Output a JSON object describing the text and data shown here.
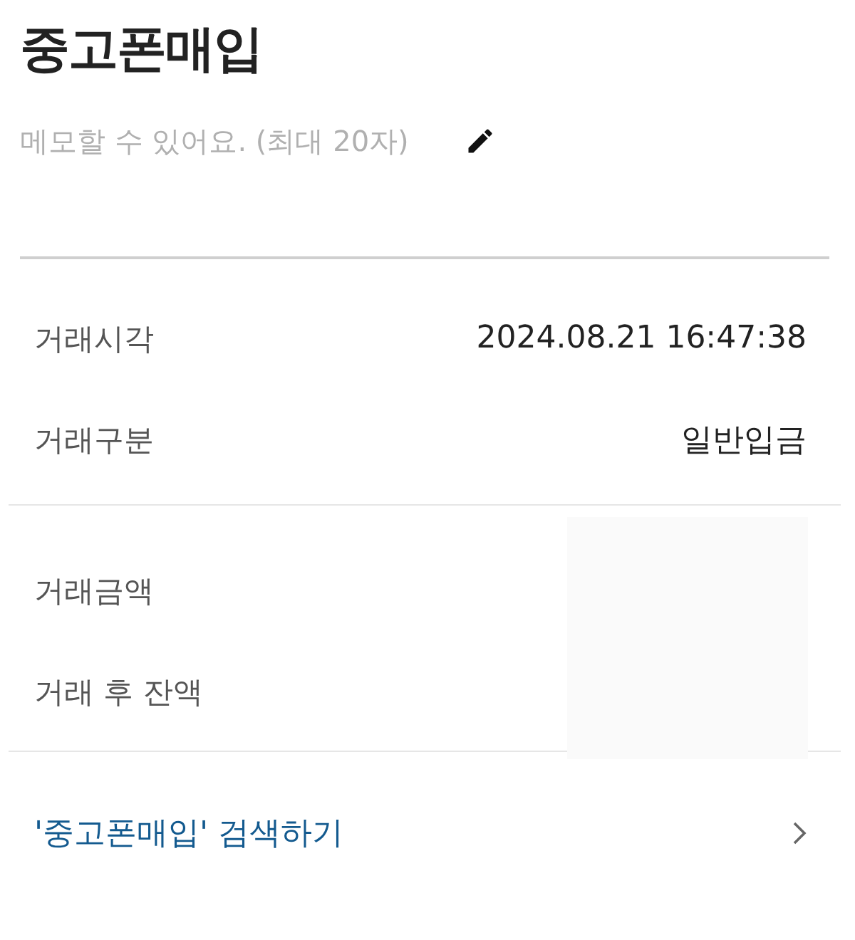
{
  "title": "중고폰매입",
  "memo": {
    "placeholder": "메모할 수 있어요. (최대 20자)"
  },
  "details": [
    {
      "label": "거래시각",
      "value": "2024.08.21 16:47:38"
    },
    {
      "label": "거래구분",
      "value": "일반입금"
    }
  ],
  "balances": [
    {
      "label": "거래금액"
    },
    {
      "label": "거래 후 잔액"
    }
  ],
  "search_link": {
    "label": "'중고폰매입' 검색하기"
  }
}
